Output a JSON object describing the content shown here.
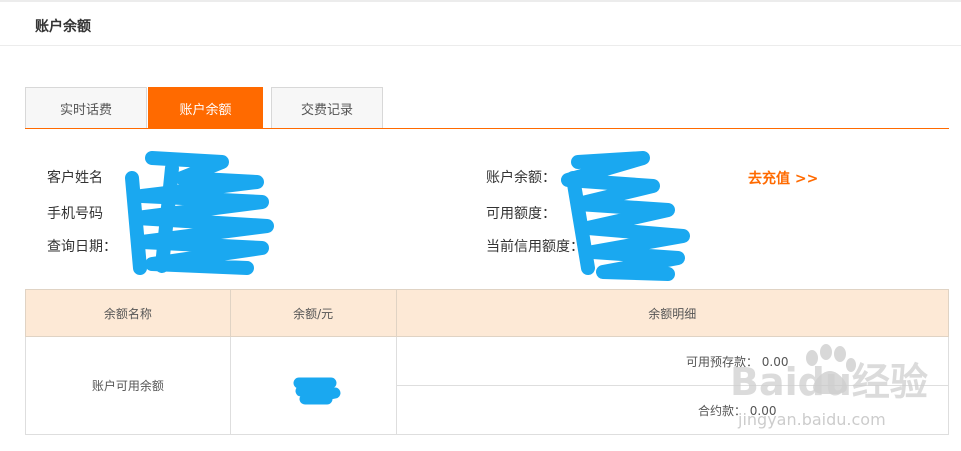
{
  "header": {
    "title": "账户余额"
  },
  "tabs": [
    {
      "label": "实时话费",
      "active": false
    },
    {
      "label": "账户余额",
      "active": true
    },
    {
      "label": "交费记录",
      "active": false
    }
  ],
  "customer_info": {
    "name_label": "客户姓名",
    "phone_label": "手机号码",
    "query_date_label": "查询日期：",
    "balance_label": "账户余额：",
    "available_label": "可用额度：",
    "credit_label": "当前信用额度：",
    "recharge_link": "去充值 >>"
  },
  "table": {
    "headers": [
      "余额名称",
      "余额/元",
      "余额明细"
    ],
    "row": {
      "name": "账户可用余额",
      "details": [
        "可用预存款： 0.00",
        "合约款： 0.00"
      ]
    }
  },
  "watermark": {
    "brand": "Baidu经验",
    "url": "jingyan.baidu.com"
  },
  "colors": {
    "accent": "#ff6a00",
    "redaction": "#1aa8f0",
    "table_header_bg": "#fde9d6"
  }
}
